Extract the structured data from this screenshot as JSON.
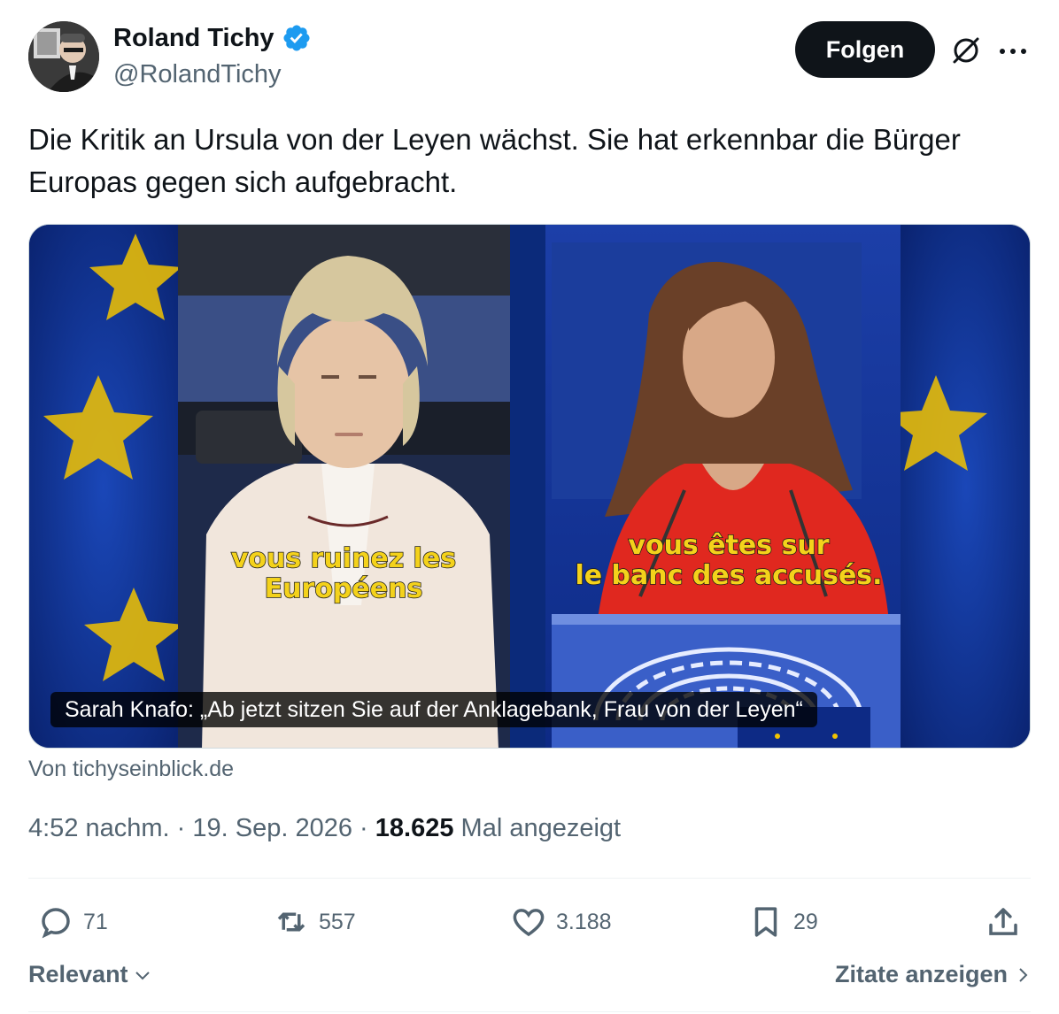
{
  "author": {
    "display_name": "Roland Tichy",
    "handle": "@RolandTichy",
    "verified": true
  },
  "follow_label": "Folgen",
  "tweet_text": "Die Kritik an Ursula von der Leyen wächst. Sie hat erkennbar die Bürger Europas gegen sich aufgebracht.",
  "media": {
    "overlay_left": [
      "vous ruinez les",
      "Européens"
    ],
    "overlay_right": [
      "vous êtes sur",
      "le banc des accusés."
    ],
    "caption": "Sarah Knafo: „Ab jetzt sitzen Sie auf der Anklagebank, Frau von der Leyen“"
  },
  "source_label": "Von tichyseinblick.de",
  "meta": {
    "time": "4:52 nachm.",
    "separator": " · ",
    "date": "19. Sep. 2026",
    "views": "18.625",
    "views_label": " Mal angezeigt"
  },
  "actions": {
    "replies": "71",
    "reposts": "557",
    "likes": "3.188",
    "bookmarks": "29"
  },
  "sort_label": "Relevant",
  "quotes_label": "Zitate anzeigen",
  "colors": {
    "text_primary": "#0f1419",
    "text_secondary": "#536471",
    "verified_blue": "#1d9bf0",
    "eu_blue": "#0b2a7a",
    "eu_gold": "#f2c300"
  }
}
